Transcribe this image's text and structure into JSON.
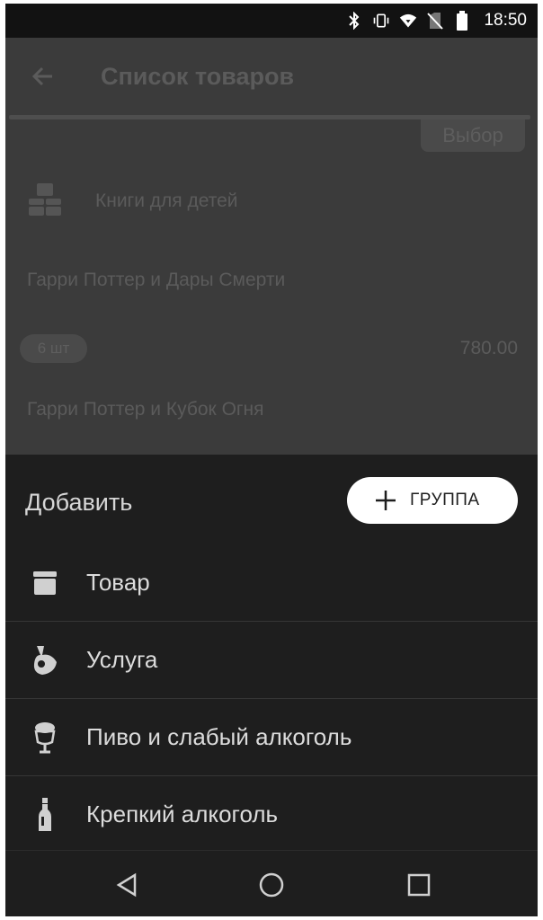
{
  "status_bar": {
    "time": "18:50",
    "icons": [
      "bluetooth-icon",
      "vibrate-icon",
      "wifi-icon",
      "no-sim-icon",
      "battery-icon"
    ]
  },
  "background_screen": {
    "title": "Список товаров",
    "choose_button": "Выбор",
    "group_label": "Книги для детей",
    "items": [
      {
        "name": "Гарри Поттер и Дары Смерти",
        "quantity": "6 шт",
        "price": "780.00"
      },
      {
        "name": "Гарри Поттер и Кубок Огня"
      }
    ]
  },
  "sheet": {
    "title": "Добавить",
    "group_button_label": "ГРУППА",
    "items": [
      {
        "label": "Товар",
        "icon": "box-icon"
      },
      {
        "label": "Услуга",
        "icon": "hand-ok-icon"
      },
      {
        "label": "Пиво и слабый алкоголь",
        "icon": "beer-glass-icon"
      },
      {
        "label": "Крепкий алкоголь",
        "icon": "bottle-icon"
      }
    ]
  },
  "colors": {
    "sheet_bg": "#1e1e1e",
    "scrim": "#3b3b3b",
    "button_bg": "#ffffff"
  }
}
